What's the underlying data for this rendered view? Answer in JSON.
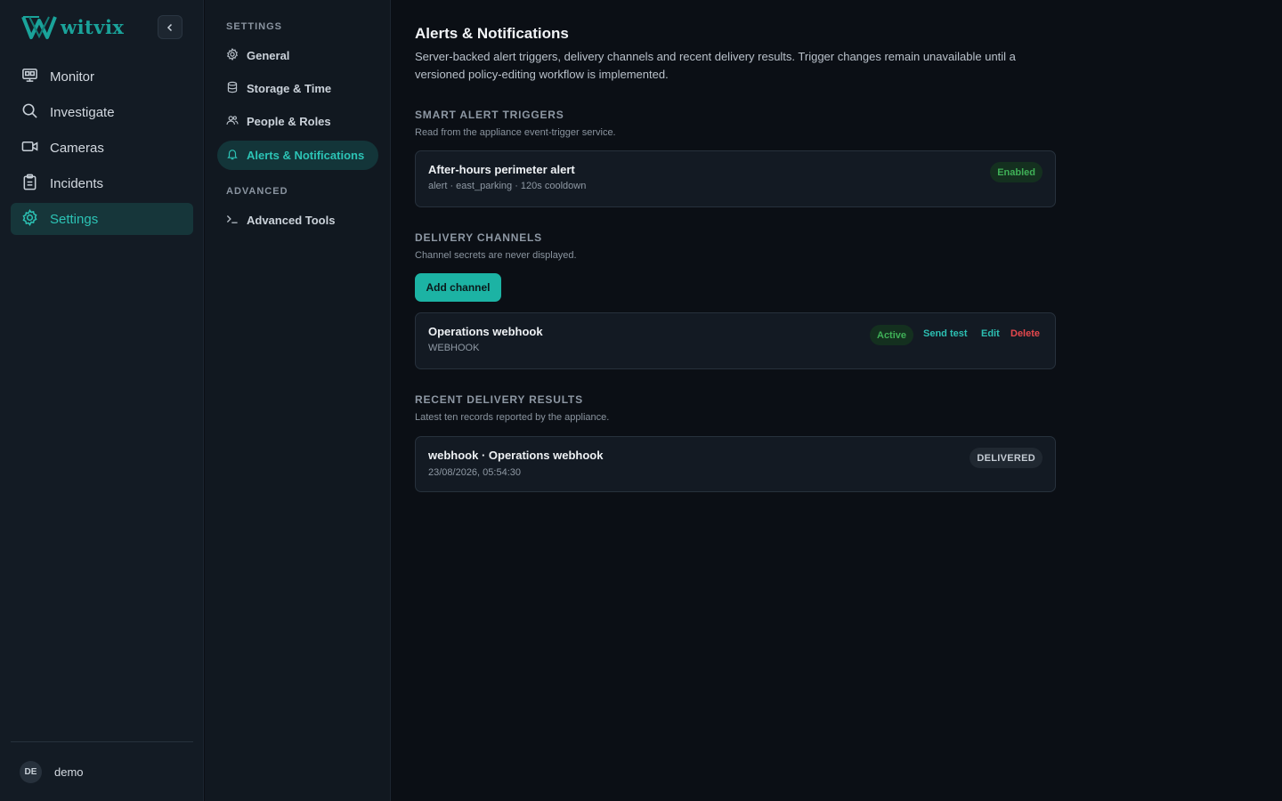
{
  "brand": {
    "name": "witvix"
  },
  "sidebar": {
    "items": [
      {
        "label": "Monitor",
        "icon": "monitor-icon"
      },
      {
        "label": "Investigate",
        "icon": "search-icon"
      },
      {
        "label": "Cameras",
        "icon": "video-camera-icon"
      },
      {
        "label": "Incidents",
        "icon": "clipboard-icon"
      },
      {
        "label": "Settings",
        "icon": "gear-icon",
        "active": true
      }
    ],
    "user": {
      "initials": "DE",
      "name": "demo"
    }
  },
  "settings_nav": {
    "section_settings": "SETTINGS",
    "section_advanced": "ADVANCED",
    "items": [
      {
        "label": "General",
        "icon": "gear-icon"
      },
      {
        "label": "Storage & Time",
        "icon": "database-icon"
      },
      {
        "label": "People & Roles",
        "icon": "users-icon"
      },
      {
        "label": "Alerts & Notifications",
        "icon": "bell-icon",
        "active": true
      }
    ],
    "advanced_items": [
      {
        "label": "Advanced Tools",
        "icon": "terminal-icon"
      }
    ]
  },
  "main": {
    "title": "Alerts & Notifications",
    "description": "Server-backed alert triggers, delivery channels and recent delivery results. Trigger changes remain unavailable until a versioned policy-editing workflow is implemented.",
    "triggers": {
      "heading": "SMART ALERT TRIGGERS",
      "subheading": "Read from the appliance event-trigger service.",
      "items": [
        {
          "name": "After-hours perimeter alert",
          "meta": "alert · east_parking · 120s cooldown",
          "status": "Enabled"
        }
      ]
    },
    "channels": {
      "heading": "DELIVERY CHANNELS",
      "subheading": "Channel secrets are never displayed.",
      "add_label": "Add channel",
      "items": [
        {
          "name": "Operations webhook",
          "type": "WEBHOOK",
          "status": "Active",
          "send_test": "Send test",
          "edit": "Edit",
          "delete": "Delete"
        }
      ]
    },
    "results": {
      "heading": "RECENT DELIVERY RESULTS",
      "subheading": "Latest ten records reported by the appliance.",
      "items": [
        {
          "name": "webhook · Operations webhook",
          "time": "23/08/2026, 05:54:30",
          "status": "DELIVERED"
        }
      ]
    }
  },
  "colors": {
    "accent": "#1cb3a4",
    "success": "#3fb057",
    "danger": "#e5484d",
    "background": "#0b0f15"
  }
}
